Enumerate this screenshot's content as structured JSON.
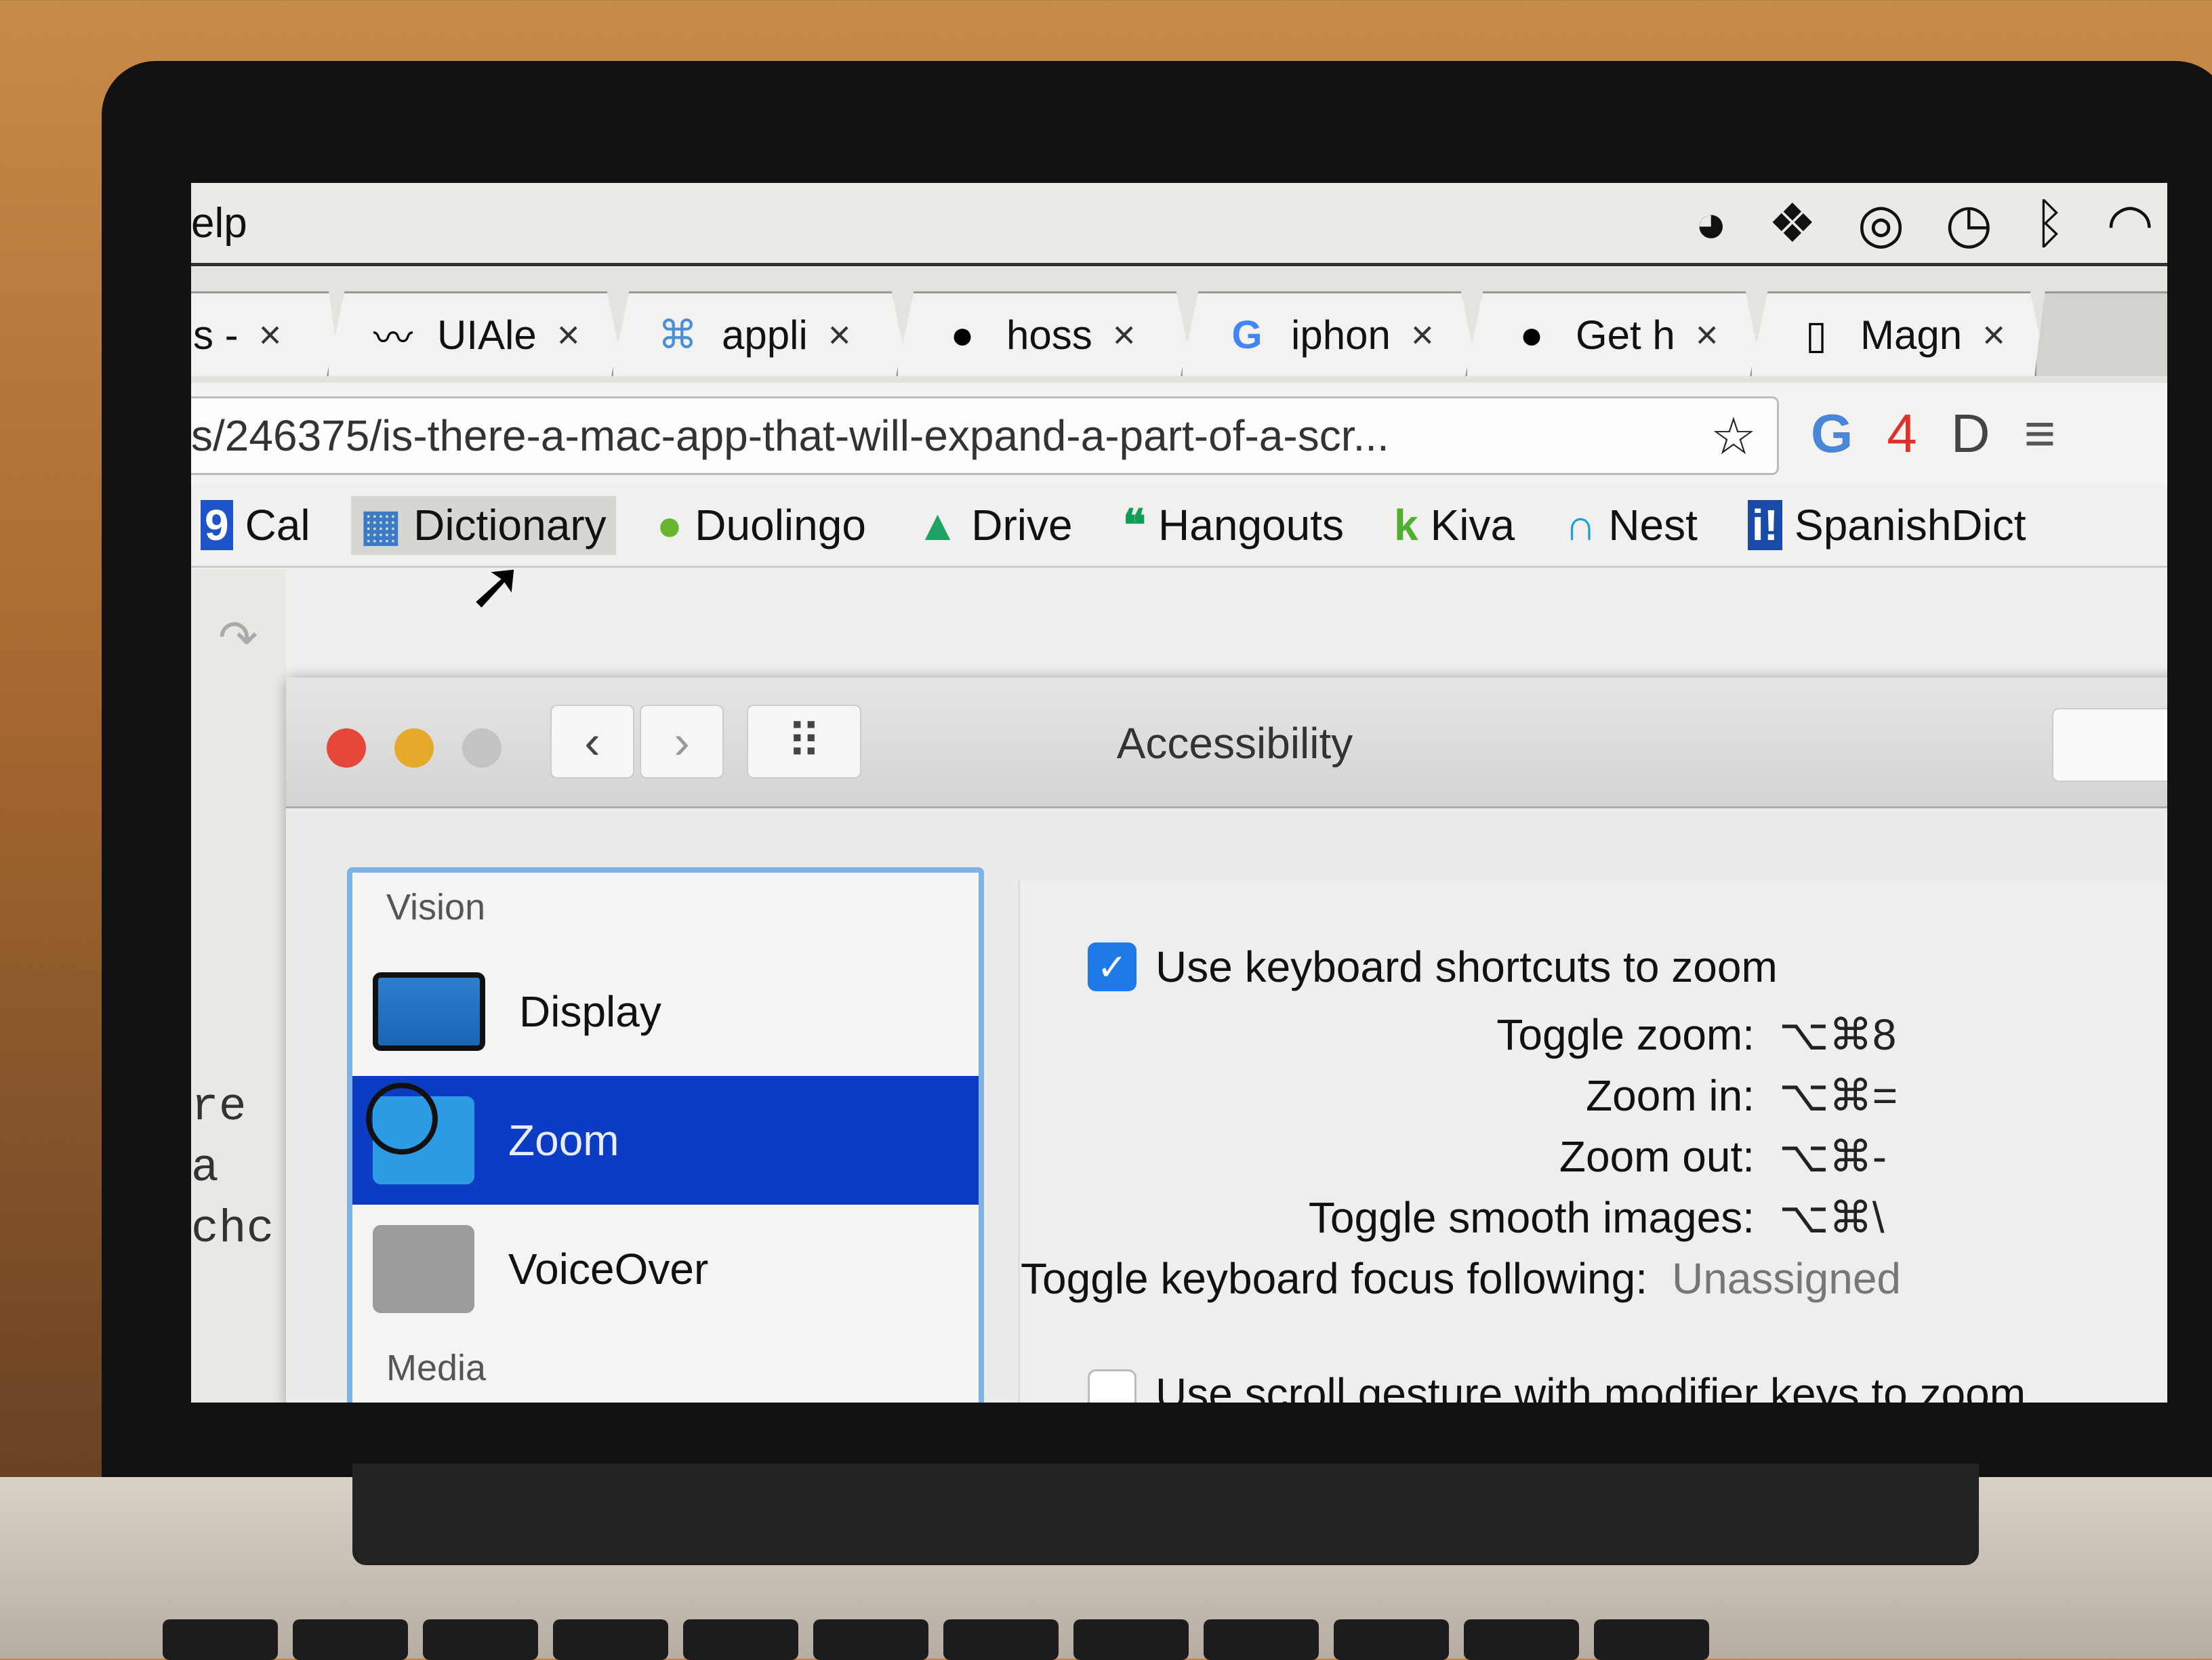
{
  "menubar": {
    "partial_menu": "elp",
    "status_icons": [
      "agent-check-icon",
      "dropbox-icon",
      "gauge-icon",
      "time-machine-icon",
      "bluetooth-icon",
      "wifi-icon"
    ]
  },
  "tabs": [
    {
      "icon": "partial",
      "title": "s -"
    },
    {
      "icon": "mustache-icon",
      "title": "UIAle"
    },
    {
      "icon": "command-icon",
      "title": "appli"
    },
    {
      "icon": "github-icon",
      "title": "hoss"
    },
    {
      "icon": "google-icon",
      "title": "iphon"
    },
    {
      "icon": "apple-icon",
      "title": "Get h"
    },
    {
      "icon": "document-icon",
      "title": "Magn"
    }
  ],
  "tab_close_glyph": "×",
  "omnibox": {
    "url": "s/246375/is-there-a-mac-app-that-will-expand-a-part-of-a-scr...",
    "bookmark_star": "☆"
  },
  "extensions": [
    {
      "name": "google-translate-icon",
      "glyph": "G"
    },
    {
      "name": "lastpass-badge-icon",
      "glyph": "4"
    },
    {
      "name": "disconnect-icon",
      "glyph": "D"
    },
    {
      "name": "reader-icon",
      "glyph": "≡"
    }
  ],
  "bookmarks": [
    {
      "icon": "calendar-icon",
      "glyph": "9",
      "label": "Cal",
      "color": "#1f54c8"
    },
    {
      "icon": "dictionary-icon",
      "glyph": "▦",
      "label": "Dictionary",
      "color": "#3b7bc6"
    },
    {
      "icon": "duolingo-icon",
      "glyph": "●",
      "label": "Duolingo",
      "color": "#68b52f"
    },
    {
      "icon": "drive-icon",
      "glyph": "▲",
      "label": "Drive",
      "color": "#1da462"
    },
    {
      "icon": "hangouts-icon",
      "glyph": "❝",
      "label": "Hangouts",
      "color": "#0f9d58"
    },
    {
      "icon": "kiva-icon",
      "glyph": "k",
      "label": "Kiva",
      "color": "#4faf2f"
    },
    {
      "icon": "nest-icon",
      "glyph": "∩",
      "label": "Nest",
      "color": "#17a2d8"
    },
    {
      "icon": "spanishdict-icon",
      "glyph": "i!",
      "label": "SpanishDict",
      "color": "#1a4aa8"
    }
  ],
  "background_page": {
    "text_line1": "re a",
    "text_line2": " chc"
  },
  "window": {
    "title": "Accessibility",
    "back_glyph": "‹",
    "forward_glyph": "›",
    "grid_glyph": "⠿",
    "traffic_lights": {
      "close": "#e5473b",
      "minimize": "#e5aa2b",
      "zoom": "#c4c4c4"
    },
    "sidebar": {
      "section": "Vision",
      "items": [
        {
          "label": "Display",
          "icon": "display-icon",
          "selected": false
        },
        {
          "label": "Zoom",
          "icon": "zoom-icon",
          "selected": true
        },
        {
          "label": "VoiceOver",
          "icon": "voiceover-icon",
          "selected": false
        }
      ],
      "next_section_partial": "Media"
    },
    "content": {
      "keyboard_shortcuts": {
        "label": "Use keyboard shortcuts to zoom",
        "checked": true
      },
      "shortcuts": [
        {
          "label": "Toggle zoom:",
          "keys": "⌥⌘8"
        },
        {
          "label": "Zoom in:",
          "keys": "⌥⌘="
        },
        {
          "label": "Zoom out:",
          "keys": "⌥⌘-"
        },
        {
          "label": "Toggle smooth images:",
          "keys": "⌥⌘\\"
        },
        {
          "label": "Toggle keyboard focus following:",
          "keys": "Unassigned"
        }
      ],
      "scroll_gesture": {
        "label": "Use scroll gesture with modifier keys to zoom",
        "checked": false
      }
    }
  }
}
